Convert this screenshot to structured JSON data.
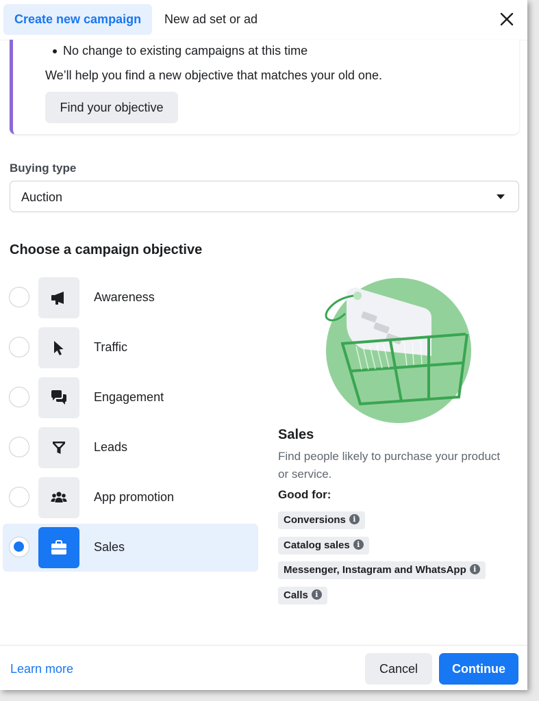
{
  "header": {
    "tabs": [
      {
        "label": "Create new campaign",
        "active": true
      },
      {
        "label": "New ad set or ad",
        "active": false
      }
    ],
    "close_icon": "close-icon"
  },
  "info_card": {
    "bullet": "No change to existing campaigns at this time",
    "help_text": "We’ll help you find a new objective that matches your old one.",
    "button_label": "Find your objective",
    "accent_color": "#8a6ad8"
  },
  "buying_type": {
    "label": "Buying type",
    "selected": "Auction"
  },
  "objectives": {
    "heading": "Choose a campaign objective",
    "items": [
      {
        "label": "Awareness",
        "icon": "megaphone-icon",
        "selected": false
      },
      {
        "label": "Traffic",
        "icon": "cursor-icon",
        "selected": false
      },
      {
        "label": "Engagement",
        "icon": "chat-bubbles-icon",
        "selected": false
      },
      {
        "label": "Leads",
        "icon": "funnel-icon",
        "selected": false
      },
      {
        "label": "App promotion",
        "icon": "people-group-icon",
        "selected": false
      },
      {
        "label": "Sales",
        "icon": "shopping-bag-icon",
        "selected": true
      }
    ]
  },
  "detail": {
    "illustration": "shopping-cart-tag-illustration",
    "title": "Sales",
    "description": "Find people likely to purchase your product or service.",
    "good_for_label": "Good for:",
    "chips": [
      "Conversions",
      "Catalog sales",
      "Messenger, Instagram and WhatsApp",
      "Calls"
    ]
  },
  "footer": {
    "learn_more": "Learn more",
    "cancel": "Cancel",
    "continue": "Continue"
  },
  "colors": {
    "primary": "#1877f2",
    "selected_bg": "#e7f0fd",
    "illustration_green": "#93d19b"
  }
}
